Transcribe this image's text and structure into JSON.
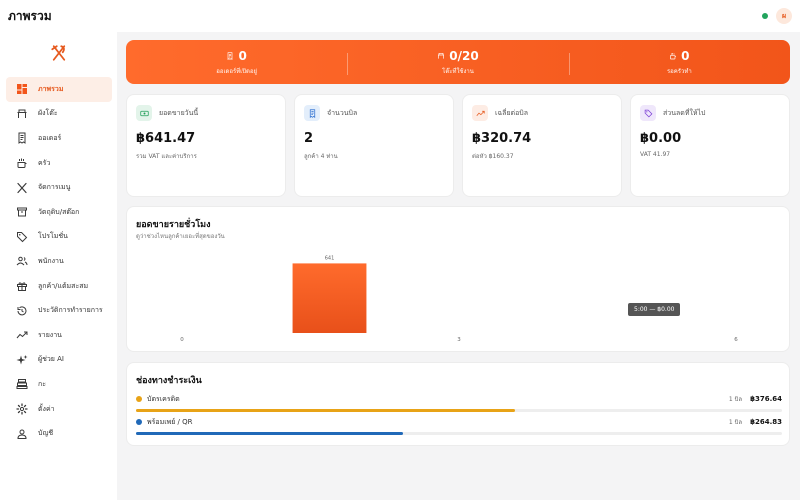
{
  "header": {
    "title": "ภาพรวม",
    "avatar": "ผ"
  },
  "sidebar": {
    "items": [
      {
        "label": "ภาพรวม",
        "icon": "dashboard-icon",
        "active": true
      },
      {
        "label": "ผังโต๊ะ",
        "icon": "table-icon"
      },
      {
        "label": "ออเดอร์",
        "icon": "receipt-icon"
      },
      {
        "label": "ครัว",
        "icon": "kitchen-icon"
      },
      {
        "label": "จัดการเมนู",
        "icon": "utensils-icon"
      },
      {
        "label": "วัตถุดิบ/สต๊อก",
        "icon": "archive-icon"
      },
      {
        "label": "โปรโมชั่น",
        "icon": "tag-icon"
      },
      {
        "label": "พนักงาน",
        "icon": "users-icon"
      },
      {
        "label": "ลูกค้า/แต้มสะสม",
        "icon": "gift-icon"
      },
      {
        "label": "ประวัติการทำรายการ",
        "icon": "history-icon"
      },
      {
        "label": "รายงาน",
        "icon": "trend-icon"
      },
      {
        "label": "ผู้ช่วย AI",
        "icon": "sparkle-icon"
      },
      {
        "label": "กะ",
        "icon": "register-icon"
      },
      {
        "label": "ตั้งค่า",
        "icon": "gear-icon"
      },
      {
        "label": "บัญชี",
        "icon": "user-icon"
      }
    ]
  },
  "banner": {
    "items": [
      {
        "value": "0",
        "label": "ออเดอร์ที่เปิดอยู่",
        "icon": "receipt-icon"
      },
      {
        "value": "0/20",
        "label": "โต๊ะที่ใช้งาน",
        "icon": "table-icon"
      },
      {
        "value": "0",
        "label": "รอครัวทำ",
        "icon": "kitchen-icon"
      }
    ]
  },
  "stats": [
    {
      "label": "ยอดขายวันนี้",
      "value": "฿641.47",
      "sub": "รวม VAT และค่าบริการ",
      "icon": "cash-icon",
      "chip_bg": "#e3f4ea",
      "chip_fg": "#1f9d57"
    },
    {
      "label": "จำนวนบิล",
      "value": "2",
      "sub": "ลูกค้า 4 ท่าน",
      "icon": "receipt-icon",
      "chip_bg": "#e3eefb",
      "chip_fg": "#2d6fd0"
    },
    {
      "label": "เฉลี่ยต่อบิล",
      "value": "฿320.74",
      "sub": "ต่อหัว ฿160.37",
      "icon": "trend-icon",
      "chip_bg": "#fdece4",
      "chip_fg": "#e65a1f"
    },
    {
      "label": "ส่วนลดที่ให้ไป",
      "value": "฿0.00",
      "sub": "VAT 41.97",
      "icon": "tag-icon",
      "chip_bg": "#efe7fb",
      "chip_fg": "#7c3fd6"
    }
  ],
  "hourly": {
    "title": "ยอดขายรายชั่วโมง",
    "subtitle": "ดูว่าช่วงไหนลูกค้าเยอะที่สุดของวัน",
    "tooltip": "5:00 — ฿0.00"
  },
  "chart_data": {
    "type": "bar",
    "x": [
      0,
      1,
      2,
      3,
      4,
      5,
      6
    ],
    "values": [
      0,
      641,
      0,
      0,
      0,
      0,
      0
    ],
    "data_labels": [
      "",
      "641",
      "",
      "",
      "",
      "",
      ""
    ],
    "x_tick_labels": [
      "0",
      "3",
      "6"
    ],
    "x_ticks": [
      0,
      3,
      6
    ],
    "ylim": [
      0,
      700
    ],
    "grid": false,
    "color": "#f2551a"
  },
  "payments": {
    "title": "ช่องทางชำระเงิน",
    "items": [
      {
        "name": "บัตรเครดิต",
        "count": "1 บิล",
        "amount": "฿376.64",
        "share": 0.587,
        "color": "#e8a317"
      },
      {
        "name": "พร้อมเพย์ / QR",
        "count": "1 บิล",
        "amount": "฿264.83",
        "share": 0.413,
        "color": "#2069b8"
      }
    ]
  },
  "colors": {
    "accent": "#f2551a",
    "online": "#22a45d"
  }
}
